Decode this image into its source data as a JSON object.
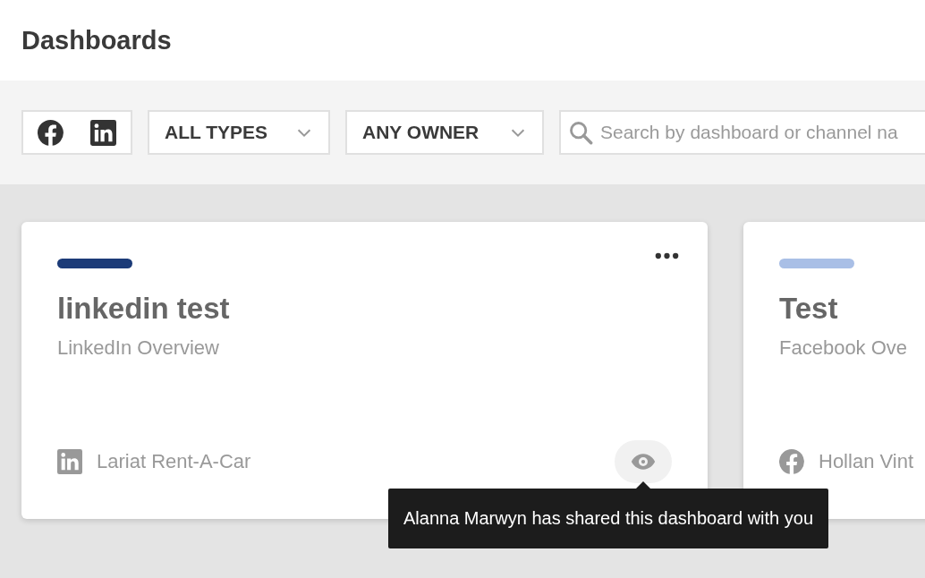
{
  "page": {
    "title": "Dashboards"
  },
  "filters": {
    "platforms": [
      {
        "kind": "facebook"
      },
      {
        "kind": "linkedin"
      }
    ],
    "dropdowns": [
      "ALL TYPES",
      "ANY OWNER"
    ],
    "search": {
      "placeholder": "Search by dashboard or channel na"
    }
  },
  "cards": [
    {
      "color": "#1c3b78",
      "title": "linkedin test",
      "subtitle": "LinkedIn Overview",
      "kind": "linkedin",
      "channel": "Lariat Rent-A-Car",
      "actions": true,
      "tooltip": "Alanna Marwyn has shared this dashboard with you"
    },
    {
      "color": "#a9bfe6",
      "title": "Test",
      "subtitle": "Facebook Ove",
      "kind": "facebook",
      "channel": "Hollan Vint"
    }
  ]
}
